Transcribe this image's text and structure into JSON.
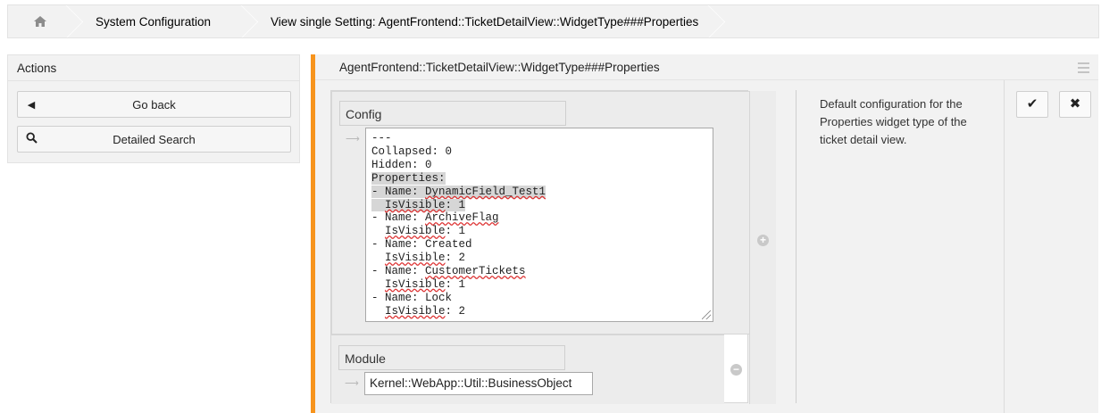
{
  "breadcrumb": {
    "home_icon": "home-icon",
    "items": [
      "System Configuration",
      "View single Setting: AgentFrontend::TicketDetailView::WidgetType###Properties"
    ]
  },
  "sidebar": {
    "title": "Actions",
    "buttons": [
      {
        "label": "Go back",
        "icon": "caret-left-icon"
      },
      {
        "label": "Detailed Search",
        "icon": "search-icon"
      }
    ]
  },
  "setting": {
    "title": "AgentFrontend::TicketDetailView::WidgetType###Properties",
    "config_label": "Config",
    "module_label": "Module",
    "module_value": "Kernel::WebApp::Util::BusinessObject",
    "description": "Default configuration for the Properties widget type of the ticket detail view.",
    "code_lines": [
      "---",
      "Collapsed: 0",
      "Hidden: 0",
      "Properties:",
      "- Name: DynamicField_Test1",
      "  IsVisible: 1",
      "- Name: ArchiveFlag",
      "  IsVisible: 1",
      "- Name: Created",
      "  IsVisible: 2",
      "- Name: CustomerTickets",
      "  IsVisible: 1",
      "- Name: Lock",
      "  IsVisible: 2"
    ],
    "accent_color": "#f7941d"
  }
}
